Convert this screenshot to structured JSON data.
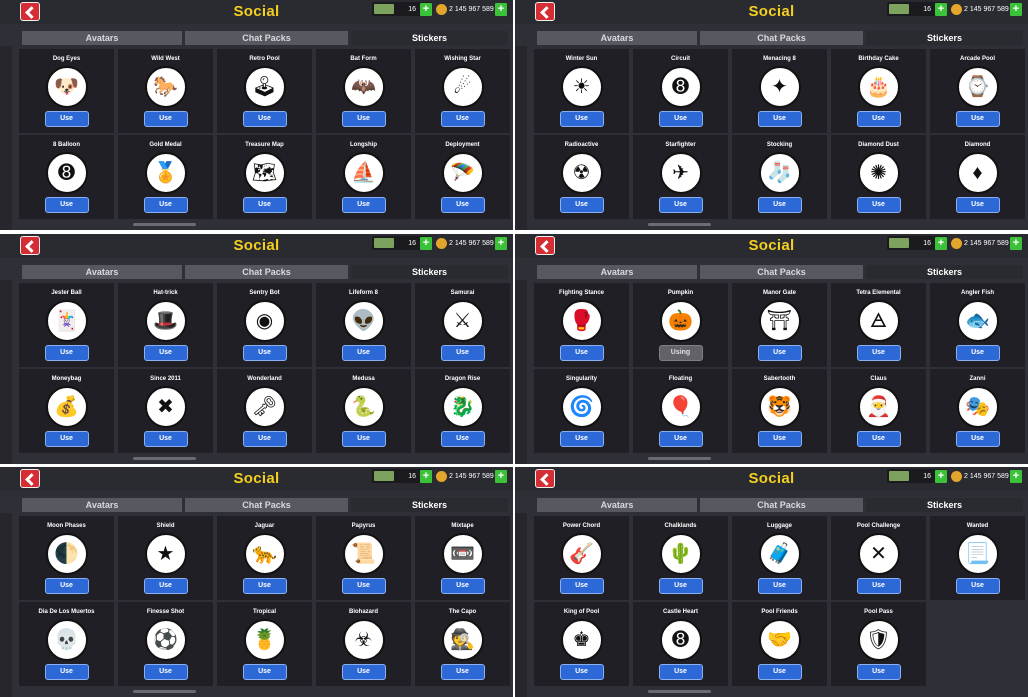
{
  "panels": [
    {
      "title": "Social",
      "cash": "16",
      "coins": "2 145 967 589",
      "tabs": [
        "Avatars",
        "Chat Packs",
        "Stickers"
      ],
      "stickers": [
        {
          "name": "Dog Eyes",
          "icon": "dog-eyes-icon",
          "glyph": "🐶",
          "button": "Use"
        },
        {
          "name": "Wild West",
          "icon": "wild-west-icon",
          "glyph": "🐎",
          "button": "Use"
        },
        {
          "name": "Retro Pool",
          "icon": "retro-pool-icon",
          "glyph": "🕹",
          "button": "Use"
        },
        {
          "name": "Bat Form",
          "icon": "bat-form-icon",
          "glyph": "🦇",
          "button": "Use"
        },
        {
          "name": "Wishing Star",
          "icon": "wishing-star-icon",
          "glyph": "☄",
          "button": "Use"
        },
        {
          "name": "8 Balloon",
          "icon": "8-balloon-icon",
          "glyph": "➑",
          "button": "Use"
        },
        {
          "name": "Gold Medal",
          "icon": "gold-medal-icon",
          "glyph": "🏅",
          "button": "Use"
        },
        {
          "name": "Treasure Map",
          "icon": "treasure-map-icon",
          "glyph": "🗺",
          "button": "Use"
        },
        {
          "name": "Longship",
          "icon": "longship-icon",
          "glyph": "⛵",
          "button": "Use"
        },
        {
          "name": "Deployment",
          "icon": "deployment-icon",
          "glyph": "🪂",
          "button": "Use"
        }
      ]
    },
    {
      "title": "Social",
      "cash": "16",
      "coins": "2 145 967 589",
      "tabs": [
        "Avatars",
        "Chat Packs",
        "Stickers"
      ],
      "stickers": [
        {
          "name": "Winter Sun",
          "icon": "winter-sun-icon",
          "glyph": "☀",
          "button": "Use"
        },
        {
          "name": "Circuit",
          "icon": "circuit-icon",
          "glyph": "➑",
          "button": "Use"
        },
        {
          "name": "Menacing 8",
          "icon": "menacing-8-icon",
          "glyph": "✦",
          "button": "Use"
        },
        {
          "name": "Birthday Cake",
          "icon": "birthday-cake-icon",
          "glyph": "🎂",
          "button": "Use"
        },
        {
          "name": "Arcade Pool",
          "icon": "arcade-pool-icon",
          "glyph": "⌚",
          "button": "Use"
        },
        {
          "name": "Radioactive",
          "icon": "radioactive-icon",
          "glyph": "☢",
          "button": "Use"
        },
        {
          "name": "Starfighter",
          "icon": "starfighter-icon",
          "glyph": "✈",
          "button": "Use"
        },
        {
          "name": "Stocking",
          "icon": "stocking-icon",
          "glyph": "🧦",
          "button": "Use"
        },
        {
          "name": "Diamond Dust",
          "icon": "diamond-dust-icon",
          "glyph": "✺",
          "button": "Use"
        },
        {
          "name": "Diamond",
          "icon": "diamond-icon",
          "glyph": "♦",
          "button": "Use"
        }
      ]
    },
    {
      "title": "Social",
      "cash": "16",
      "coins": "2 145 967 589",
      "tabs": [
        "Avatars",
        "Chat Packs",
        "Stickers"
      ],
      "stickers": [
        {
          "name": "Jester Ball",
          "icon": "jester-ball-icon",
          "glyph": "🃏",
          "button": "Use"
        },
        {
          "name": "Hat-trick",
          "icon": "hat-trick-icon",
          "glyph": "🎩",
          "button": "Use"
        },
        {
          "name": "Sentry Bot",
          "icon": "sentry-bot-icon",
          "glyph": "◉",
          "button": "Use"
        },
        {
          "name": "Lifeform 8",
          "icon": "lifeform-8-icon",
          "glyph": "👽",
          "button": "Use"
        },
        {
          "name": "Samurai",
          "icon": "samurai-icon",
          "glyph": "⚔",
          "button": "Use"
        },
        {
          "name": "Moneybag",
          "icon": "moneybag-icon",
          "glyph": "💰",
          "button": "Use"
        },
        {
          "name": "Since 2011",
          "icon": "since-2011-icon",
          "glyph": "✖",
          "button": "Use"
        },
        {
          "name": "Wonderland",
          "icon": "wonderland-icon",
          "glyph": "🗝",
          "button": "Use"
        },
        {
          "name": "Medusa",
          "icon": "medusa-icon",
          "glyph": "🐍",
          "button": "Use"
        },
        {
          "name": "Dragon Rise",
          "icon": "dragon-rise-icon",
          "glyph": "🐉",
          "button": "Use"
        }
      ]
    },
    {
      "title": "Social",
      "cash": "16",
      "coins": "2 145 967 589",
      "tabs": [
        "Avatars",
        "Chat Packs",
        "Stickers"
      ],
      "stickers": [
        {
          "name": "Fighting Stance",
          "icon": "fighting-stance-icon",
          "glyph": "🥊",
          "button": "Use"
        },
        {
          "name": "Pumpkin",
          "icon": "pumpkin-icon",
          "glyph": "🎃",
          "button": "Using"
        },
        {
          "name": "Manor Gate",
          "icon": "manor-gate-icon",
          "glyph": "⛩",
          "button": "Use"
        },
        {
          "name": "Tetra Elemental",
          "icon": "tetra-elemental-icon",
          "glyph": "🜁",
          "button": "Use"
        },
        {
          "name": "Angler Fish",
          "icon": "angler-fish-icon",
          "glyph": "🐟",
          "button": "Use"
        },
        {
          "name": "Singularity",
          "icon": "singularity-icon",
          "glyph": "🌀",
          "button": "Use"
        },
        {
          "name": "Floating",
          "icon": "floating-icon",
          "glyph": "🎈",
          "button": "Use"
        },
        {
          "name": "Sabertooth",
          "icon": "sabertooth-icon",
          "glyph": "🐯",
          "button": "Use"
        },
        {
          "name": "Claus",
          "icon": "claus-icon",
          "glyph": "🎅",
          "button": "Use"
        },
        {
          "name": "Zanni",
          "icon": "zanni-icon",
          "glyph": "🎭",
          "button": "Use"
        }
      ]
    },
    {
      "title": "Social",
      "cash": "16",
      "coins": "2 145 967 589",
      "tabs": [
        "Avatars",
        "Chat Packs",
        "Stickers"
      ],
      "stickers": [
        {
          "name": "Moon Phases",
          "icon": "moon-phases-icon",
          "glyph": "🌓",
          "button": "Use"
        },
        {
          "name": "Shield",
          "icon": "shield-icon",
          "glyph": "★",
          "button": "Use"
        },
        {
          "name": "Jaguar",
          "icon": "jaguar-icon",
          "glyph": "🐆",
          "button": "Use"
        },
        {
          "name": "Papyrus",
          "icon": "papyrus-icon",
          "glyph": "📜",
          "button": "Use"
        },
        {
          "name": "Mixtape",
          "icon": "mixtape-icon",
          "glyph": "📼",
          "button": "Use"
        },
        {
          "name": "Dia De Los Muertos",
          "icon": "dia-de-los-muertos-icon",
          "glyph": "💀",
          "button": "Use"
        },
        {
          "name": "Finesse Shot",
          "icon": "finesse-shot-icon",
          "glyph": "⚽",
          "button": "Use"
        },
        {
          "name": "Tropical",
          "icon": "tropical-icon",
          "glyph": "🍍",
          "button": "Use"
        },
        {
          "name": "Biohazard",
          "icon": "biohazard-icon",
          "glyph": "☣",
          "button": "Use"
        },
        {
          "name": "The Capo",
          "icon": "the-capo-icon",
          "glyph": "🕵",
          "button": "Use"
        }
      ]
    },
    {
      "title": "Social",
      "cash": "16",
      "coins": "2 145 967 589",
      "tabs": [
        "Avatars",
        "Chat Packs",
        "Stickers"
      ],
      "stickers": [
        {
          "name": "Power Chord",
          "icon": "power-chord-icon",
          "glyph": "🎸",
          "button": "Use"
        },
        {
          "name": "Chalklands",
          "icon": "chalklands-icon",
          "glyph": "🌵",
          "button": "Use"
        },
        {
          "name": "Luggage",
          "icon": "luggage-icon",
          "glyph": "🧳",
          "button": "Use"
        },
        {
          "name": "Pool Challenge",
          "icon": "pool-challenge-icon",
          "glyph": "✕",
          "button": "Use"
        },
        {
          "name": "Wanted",
          "icon": "wanted-icon",
          "glyph": "📃",
          "button": "Use",
          "extra": "WANTED"
        },
        {
          "name": "King of Pool",
          "icon": "king-of-pool-icon",
          "glyph": "♚",
          "button": "Use"
        },
        {
          "name": "Castle Heart",
          "icon": "castle-heart-icon",
          "glyph": "➑",
          "button": "Use"
        },
        {
          "name": "Pool Friends",
          "icon": "pool-friends-icon",
          "glyph": "🤝",
          "button": "Use"
        },
        {
          "name": "Pool Pass",
          "icon": "pool-pass-icon",
          "glyph": "🛡",
          "button": "Use"
        }
      ]
    }
  ]
}
